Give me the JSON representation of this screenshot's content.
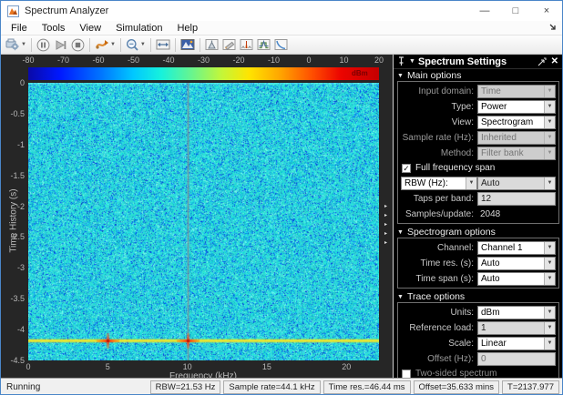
{
  "titlebar": {
    "title": "Spectrum Analyzer",
    "controls": {
      "minimize": "—",
      "maximize": "□",
      "close": "×"
    }
  },
  "menu": {
    "items": [
      "File",
      "Tools",
      "View",
      "Simulation",
      "Help"
    ]
  },
  "toolbar": {
    "icons": [
      "config-export-icon",
      "pause-icon",
      "step-forward-icon",
      "stop-icon",
      "playback-source-icon",
      "zoom-icon",
      "span-icon",
      "spectrogram-view-icon",
      "peak-finder-icon",
      "measurements-icon",
      "distortion-icon",
      "spectral-mask-icon",
      "ccdf-icon"
    ]
  },
  "figure": {
    "colorbar": {
      "ticks": [
        -80,
        -70,
        -60,
        -50,
        -40,
        -30,
        -20,
        -10,
        0,
        10,
        20
      ],
      "unit_label": "dBm"
    },
    "y_axis": {
      "label": "Time History (s)",
      "ticks": [
        0,
        -0.5,
        -1,
        -1.5,
        -2,
        -2.5,
        -3,
        -3.5,
        -4,
        -4.5
      ],
      "min": -4.5,
      "max": 0
    },
    "x_axis": {
      "label": "Frequency (kHz)",
      "ticks": [
        0,
        5,
        10,
        15,
        20
      ],
      "min": 0,
      "max": 22.05
    },
    "signal": {
      "tone_freqs_khz": [
        5,
        10
      ],
      "event_time_s": -4.18,
      "cursor_freq_khz": 10
    }
  },
  "splitter": {
    "arrow": "▸"
  },
  "settings": {
    "title": "Spectrum Settings",
    "collapse_icon": "▼",
    "close_icon": "✕",
    "main": {
      "title": "Main options",
      "input_domain": {
        "label": "Input domain:",
        "value": "Time"
      },
      "type": {
        "label": "Type:",
        "value": "Power"
      },
      "view": {
        "label": "View:",
        "value": "Spectrogram"
      },
      "sample_rate": {
        "label": "Sample rate (Hz):",
        "value": "Inherited"
      },
      "method": {
        "label": "Method:",
        "value": "Filter bank"
      },
      "full_span": {
        "label": "Full frequency span",
        "check": "✓"
      },
      "rbw": {
        "label": "RBW (Hz):",
        "value": "Auto"
      },
      "taps": {
        "label": "Taps per band:",
        "value": "12"
      },
      "samples": {
        "label": "Samples/update:",
        "value": "2048"
      }
    },
    "spectrogram": {
      "title": "Spectrogram options",
      "channel": {
        "label": "Channel:",
        "value": "Channel 1"
      },
      "time_res": {
        "label": "Time res. (s):",
        "value": "Auto"
      },
      "time_span": {
        "label": "Time span (s):",
        "value": "Auto"
      }
    },
    "trace": {
      "title": "Trace options",
      "units": {
        "label": "Units:",
        "value": "dBm"
      },
      "reference_load": {
        "label": "Reference load:",
        "value": "1"
      },
      "scale": {
        "label": "Scale:",
        "value": "Linear"
      },
      "offset": {
        "label": "Offset (Hz):",
        "value": "0"
      },
      "two_sided": {
        "label": "Two-sided spectrum"
      }
    }
  },
  "status_bar": {
    "state": "Running",
    "cells": [
      "RBW=21.53 Hz",
      "Sample rate=44.1 kHz",
      "Time res.=46.44 ms",
      "Offset=35.633 mins",
      "T=2137.977"
    ]
  }
}
